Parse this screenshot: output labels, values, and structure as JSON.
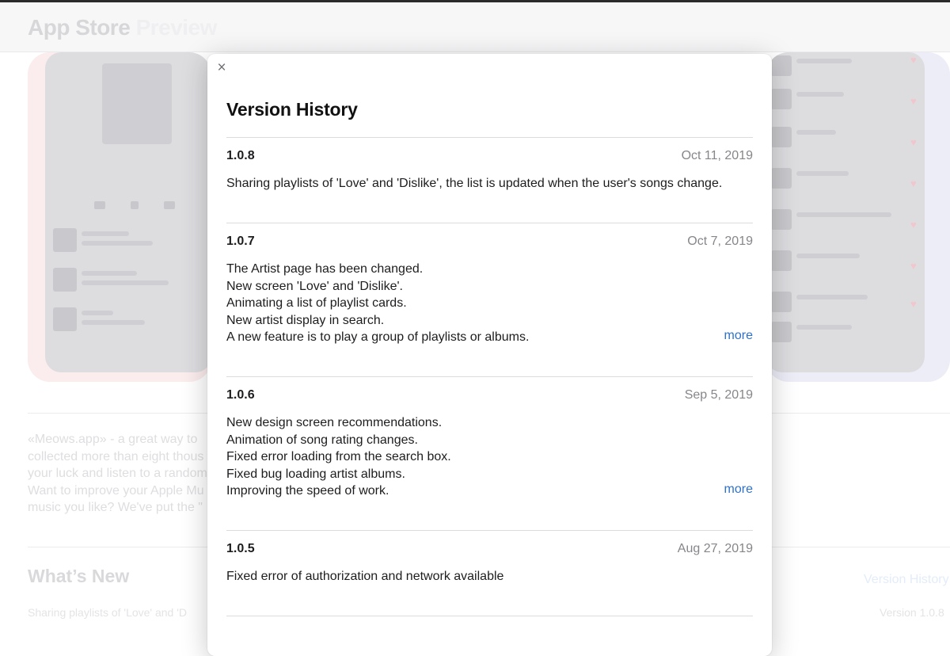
{
  "background": {
    "brand": "App Store",
    "brand_suffix": "Preview",
    "description_lines": [
      "«Meows.app» - a great way to",
      "collected more than eight thous",
      "your luck and listen to a random",
      "Want to improve your Apple Mu",
      "music you like? We've put the \""
    ],
    "whats_new_title": "What’s New",
    "version_history_link": "Version History",
    "whats_new_note": "Sharing playlists of 'Love' and 'D",
    "version_label": "Version 1.0.8"
  },
  "modal": {
    "close_label": "×",
    "title": "Version History",
    "more_label": "more",
    "entries": [
      {
        "version": "1.0.8",
        "date": "Oct 11, 2019",
        "notes": [
          "Sharing playlists of 'Love' and 'Dislike', the list is updated when the user's songs change."
        ]
      },
      {
        "version": "1.0.7",
        "date": "Oct 7, 2019",
        "notes": [
          "The Artist page has been changed.",
          "New screen 'Love' and 'Dislike'.",
          "Animating a list of playlist cards.",
          "New artist display in search.",
          "A new feature is to play a group of playlists or albums."
        ]
      },
      {
        "version": "1.0.6",
        "date": "Sep 5, 2019",
        "notes": [
          "New design screen recommendations.",
          "Animation of song rating changes.",
          "Fixed error loading from the search box.",
          "Fixed bug loading artist albums.",
          "Improving the speed of work."
        ]
      },
      {
        "version": "1.0.5",
        "date": "Aug 27, 2019",
        "notes": [
          "Fixed error of authorization and network available"
        ]
      }
    ]
  },
  "colors": {
    "link": "#2f72c9",
    "muted": "#86868b",
    "text": "#1d1d1f"
  },
  "icons": {
    "close": "close-icon",
    "heart": "heart-icon"
  }
}
